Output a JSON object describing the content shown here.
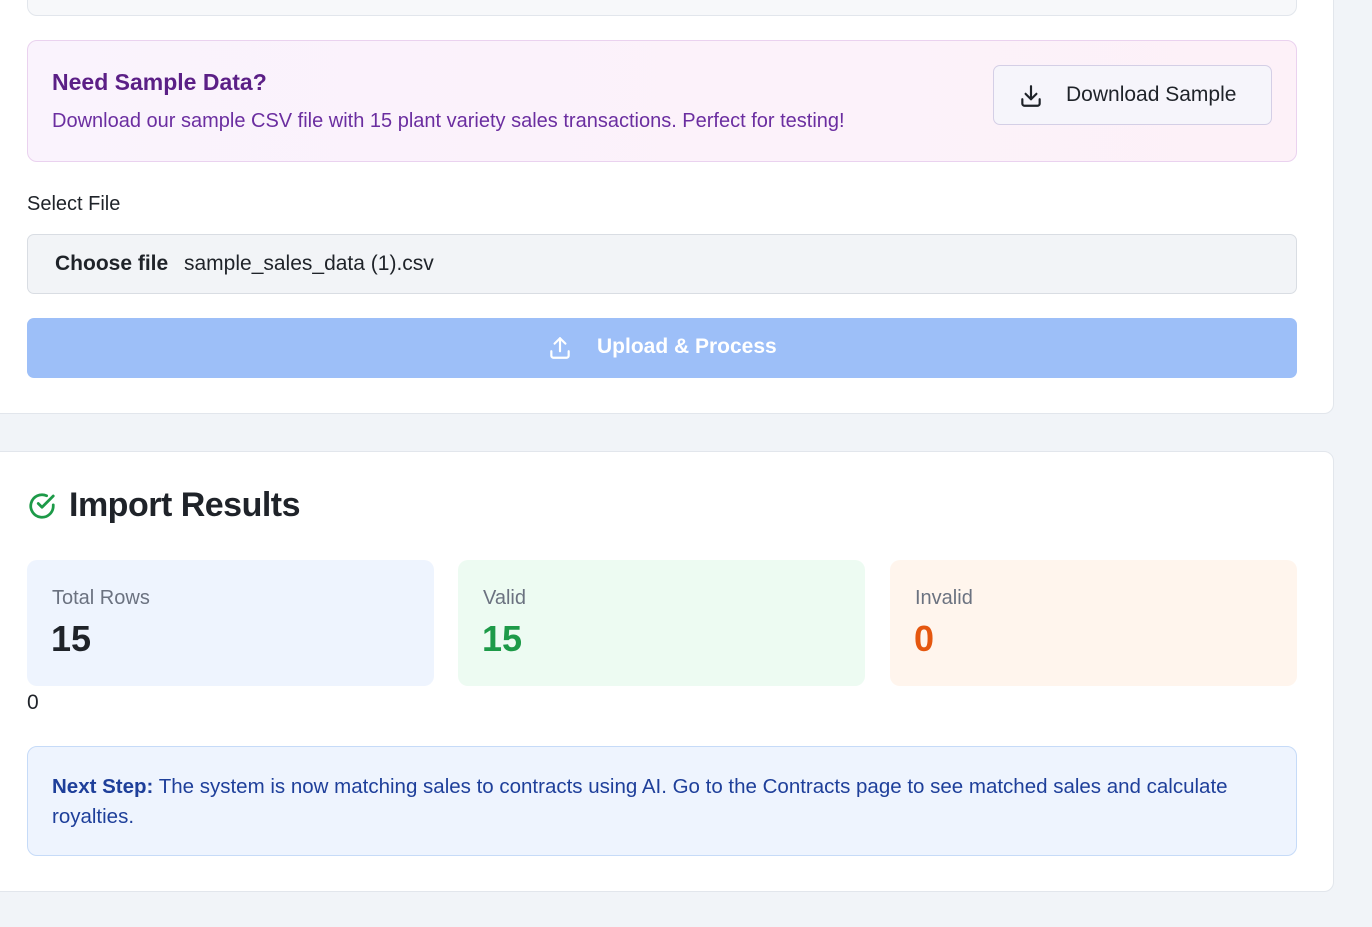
{
  "sample": {
    "title": "Need Sample Data?",
    "description": "Download our sample CSV file with 15 plant variety sales transactions. Perfect for testing!",
    "download_label": "Download Sample"
  },
  "upload": {
    "select_label": "Select File",
    "choose_label": "Choose file",
    "file_name": "sample_sales_data (1).csv",
    "button_label": "Upload & Process"
  },
  "results": {
    "title": "Import Results",
    "stats": [
      {
        "label": "Total Rows",
        "value": "15"
      },
      {
        "label": "Valid",
        "value": "15"
      },
      {
        "label": "Invalid",
        "value": "0"
      }
    ],
    "stray_value": "0",
    "next_step_label": "Next Step:",
    "next_step_text": "The system is now matching sales to contracts using AI. Go to the Contracts page to see matched sales and calculate royalties."
  },
  "colors": {
    "upload_button": "#9dbff8",
    "valid": "#1d9a48",
    "invalid": "#e5570f",
    "sample_title": "#5b1f86",
    "next_step_text": "#1e3f9a"
  },
  "icons": {
    "download": "download-icon",
    "upload": "upload-icon",
    "results": "check-circle-icon"
  }
}
